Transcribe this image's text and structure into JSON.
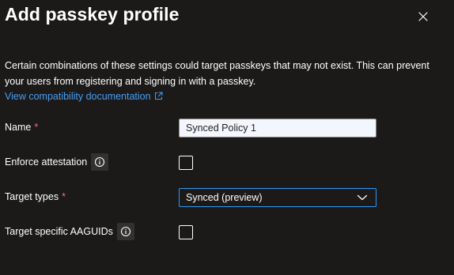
{
  "panel": {
    "title": "Add passkey profile",
    "close_icon": "close-icon"
  },
  "description": {
    "text": "Certain combinations of these settings could target passkeys that may not exist. This can prevent your users from registering and signing in with a passkey.",
    "link_text": "View compatibility documentation",
    "link_icon": "external-link-icon"
  },
  "form": {
    "name": {
      "label": "Name",
      "required_marker": "*",
      "value": "Synced Policy 1"
    },
    "enforce_attestation": {
      "label": "Enforce attestation",
      "info_icon": "info-icon",
      "checked": false
    },
    "target_types": {
      "label": "Target types",
      "required_marker": "*",
      "selected": "Synced (preview)",
      "dropdown_icon": "chevron-down-icon"
    },
    "target_aaguids": {
      "label": "Target specific AAGUIDs",
      "info_icon": "info-icon",
      "checked": false
    }
  },
  "colors": {
    "background": "#1b1a19",
    "link": "#479ef5",
    "required": "#f1707b",
    "focus_border": "#2899f5",
    "input_background": "#f3f6fd"
  }
}
